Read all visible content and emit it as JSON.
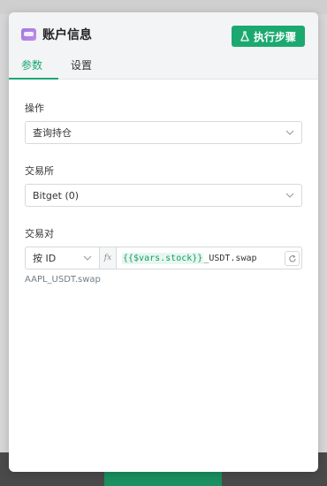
{
  "panel": {
    "title": "账户信息",
    "run_button": "执行步骤",
    "tabs": [
      {
        "label": "参数",
        "active": true
      },
      {
        "label": "设置",
        "active": false
      }
    ]
  },
  "fields": {
    "operation": {
      "label": "操作",
      "value": "查询持仓"
    },
    "exchange": {
      "label": "交易所",
      "value": "Bitget (0)"
    },
    "pair": {
      "label": "交易对",
      "mode": "按 ID",
      "fx": "fx",
      "expr_var": "{{$vars.stock}}",
      "expr_suffix": "_USDT.swap",
      "resolved_hint": "AAPL_USDT.swap"
    }
  },
  "colors": {
    "accent": "#1ba970",
    "var_chip_bg": "#e6f7ef",
    "var_chip_text": "#1a9a64"
  },
  "icons": {
    "header": "app-card-icon",
    "run": "flask-icon",
    "dropdown": "chevron-down-icon",
    "refresh": "refresh-icon"
  }
}
